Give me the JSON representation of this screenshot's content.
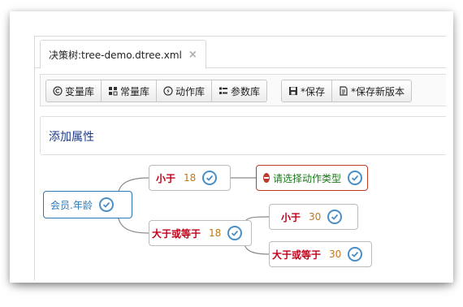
{
  "tab": {
    "title": "决策树:tree-demo.dtree.xml",
    "close": "×"
  },
  "toolbar": {
    "group1": [
      {
        "label": "变量库",
        "icon": "copyright-icon"
      },
      {
        "label": "常量库",
        "icon": "grid-icon"
      },
      {
        "label": "动作库",
        "icon": "bolt-icon"
      },
      {
        "label": "参数库",
        "icon": "list-icon"
      }
    ],
    "save_label": "*保存",
    "save_version_label": "*保存新版本"
  },
  "section": {
    "title": "添加属性"
  },
  "tree": {
    "root_label": "会员.年龄",
    "branch1": {
      "op": "小于",
      "value": "18"
    },
    "action": {
      "label": "请选择动作类型"
    },
    "branch2": {
      "op": "大于或等于",
      "value": "18"
    },
    "sub1": {
      "op": "小于",
      "value": "30"
    },
    "sub2": {
      "op": "大于或等于",
      "value": "30"
    }
  },
  "colors": {
    "accent": "#4a8ec6",
    "operator": "#c0001a",
    "value": "#c0781a",
    "action": "#1a7a1a"
  }
}
